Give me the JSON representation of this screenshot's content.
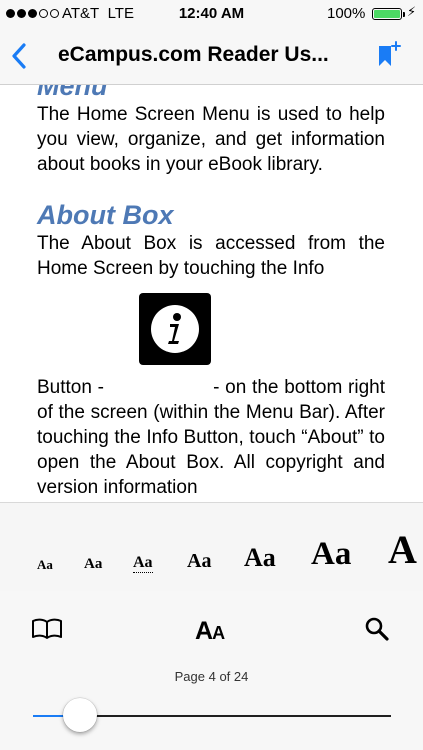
{
  "status_bar": {
    "carrier": "AT&T",
    "network": "LTE",
    "time": "12:40 AM",
    "battery_percent": "100%",
    "battery_level": 1.0,
    "signal_bars_filled": 3,
    "signal_bars_total": 5
  },
  "nav": {
    "title": "eCampus.com Reader Us...",
    "back_icon": "chevron-left-icon",
    "bookmark_icon": "bookmark-add-icon",
    "accent_color": "#1a7cf5"
  },
  "content": {
    "heading_partial": "Menu",
    "menu_paragraph": "The Home Screen Menu is used to help you view, organize, and get information about books in your eBook library.",
    "about_heading": "About Box",
    "about_paragraph_1": "The About Box is accessed from the Home Screen by touching the Info",
    "info_image_icon": "info-icon",
    "about_paragraph_2": "Button -                   - on the bottom right of the screen (within the Menu Bar). After touching the Info Button, touch “About” to open the About Box. All copyright and version information",
    "heading_color": "#4e79b5"
  },
  "font_panel": {
    "options": [
      "Aa",
      "Aa",
      "Aa",
      "Aa",
      "Aa",
      "Aa",
      "A"
    ],
    "selected_index": 2
  },
  "toolbar": {
    "toc_icon": "book-open-icon",
    "font_button_big": "A",
    "font_button_small": "A",
    "search_icon": "search-icon",
    "page_indicator": "Page 4 of 24",
    "current_page": 4,
    "total_pages": 24
  }
}
